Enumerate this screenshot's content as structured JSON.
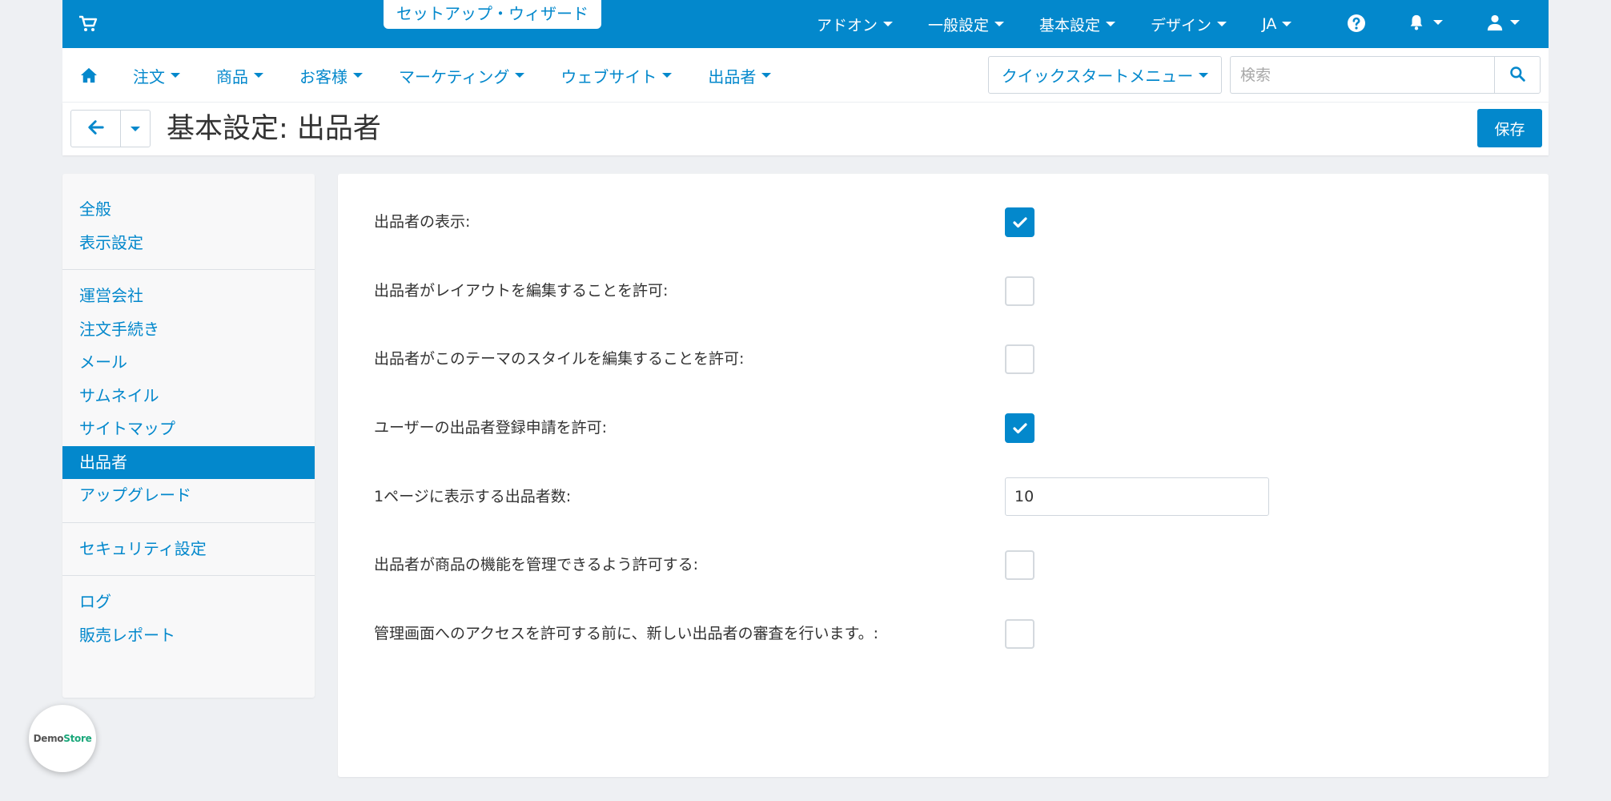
{
  "topbar": {
    "wizard_label": "セットアップ・ウィザード",
    "menu": [
      {
        "label": "アドオン"
      },
      {
        "label": "一般設定"
      },
      {
        "label": "基本設定"
      },
      {
        "label": "デザイン"
      },
      {
        "label": "JA"
      }
    ],
    "icons": [
      "cart-icon",
      "help-icon",
      "bell-icon",
      "user-icon"
    ]
  },
  "nav": {
    "items": [
      {
        "label": "注文"
      },
      {
        "label": "商品"
      },
      {
        "label": "お客様"
      },
      {
        "label": "マーケティング"
      },
      {
        "label": "ウェブサイト"
      },
      {
        "label": "出品者"
      }
    ],
    "quick_start_label": "クイックスタートメニュー",
    "search_placeholder": "検索"
  },
  "header": {
    "title": "基本設定: 出品者",
    "save_label": "保存"
  },
  "sidebar": {
    "groups": [
      [
        "全般",
        "表示設定"
      ],
      [
        "運営会社",
        "注文手続き",
        "メール",
        "サムネイル",
        "サイトマップ",
        "出品者",
        "アップグレード"
      ],
      [
        "セキュリティ設定"
      ],
      [
        "ログ",
        "販売レポート"
      ]
    ],
    "active": "出品者"
  },
  "settings": [
    {
      "label": "出品者の表示:",
      "type": "checkbox",
      "checked": true
    },
    {
      "label": "出品者がレイアウトを編集することを許可:",
      "type": "checkbox",
      "checked": false
    },
    {
      "label": "出品者がこのテーマのスタイルを編集することを許可:",
      "type": "checkbox",
      "checked": false
    },
    {
      "label": "ユーザーの出品者登録申請を許可:",
      "type": "checkbox",
      "checked": true
    },
    {
      "label": "1ページに表示する出品者数:",
      "type": "text",
      "value": "10"
    },
    {
      "label": "出品者が商品の機能を管理できるよう許可する:",
      "type": "checkbox",
      "checked": false
    },
    {
      "label": "管理画面へのアクセスを許可する前に、新しい出品者の審査を行います。:",
      "type": "checkbox",
      "checked": false
    }
  ],
  "badge": {
    "part1": "Demo",
    "part2": "Store"
  },
  "colors": {
    "primary": "#0388cc",
    "background": "#eef0f3",
    "badge_green": "#1aa77a"
  }
}
